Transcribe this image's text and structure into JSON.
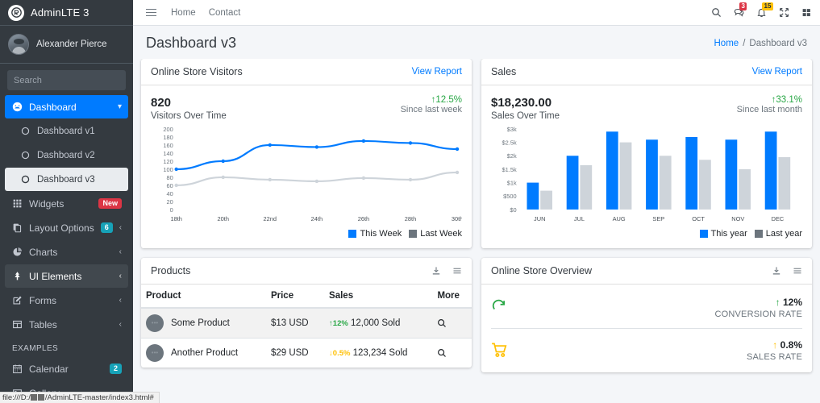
{
  "sidebar": {
    "brand": {
      "title": "AdminLTE 3",
      "logo_icon": "adminlte-logo-icon"
    },
    "user": {
      "name": "Alexander Pierce",
      "avatar_icon": "user-avatar"
    },
    "search": {
      "placeholder": "Search",
      "value": "",
      "button_icon": "search-icon"
    },
    "items": [
      {
        "label": "Dashboard",
        "icon": "tachometer-icon",
        "state": "active",
        "chevron": "⌄",
        "badge": null
      },
      {
        "label": "Dashboard v1",
        "icon": "circle-o-icon",
        "state": "sub",
        "badge": null
      },
      {
        "label": "Dashboard v2",
        "icon": "circle-o-icon",
        "state": "sub",
        "badge": null
      },
      {
        "label": "Dashboard v3",
        "icon": "circle-o-icon",
        "state": "sub-active",
        "badge": null
      },
      {
        "label": "Widgets",
        "icon": "th-icon",
        "state": "normal",
        "badge": {
          "text": "New",
          "color": "red"
        }
      },
      {
        "label": "Layout Options",
        "icon": "copy-icon",
        "state": "normal",
        "badge": {
          "text": "6",
          "color": "teal"
        },
        "chevron": "‹"
      },
      {
        "label": "Charts",
        "icon": "pie-chart-icon",
        "state": "normal",
        "badge": null,
        "chevron": "‹"
      },
      {
        "label": "UI Elements",
        "icon": "tree-icon",
        "state": "active-light",
        "badge": null,
        "chevron": "‹"
      },
      {
        "label": "Forms",
        "icon": "edit-icon",
        "state": "normal",
        "badge": null,
        "chevron": "‹"
      },
      {
        "label": "Tables",
        "icon": "table-icon",
        "state": "normal",
        "badge": null,
        "chevron": "‹"
      }
    ],
    "section_header": "EXAMPLES",
    "examples": [
      {
        "label": "Calendar",
        "icon": "calendar-icon",
        "badge": {
          "text": "2",
          "color": "teal"
        }
      },
      {
        "label": "Gallery",
        "icon": "image-icon",
        "badge": null
      }
    ]
  },
  "navbar": {
    "menu_icon": "hamburger-icon",
    "links": [
      {
        "label": "Home"
      },
      {
        "label": "Contact"
      }
    ],
    "right_icons": [
      {
        "name": "search-icon",
        "badge": null
      },
      {
        "name": "comments-icon",
        "badge": {
          "text": "3",
          "color": "red"
        }
      },
      {
        "name": "bell-icon",
        "badge": {
          "text": "15",
          "color": "yellow"
        }
      },
      {
        "name": "expand-arrows-icon",
        "badge": null
      },
      {
        "name": "th-large-icon",
        "badge": null
      }
    ]
  },
  "content_header": {
    "title": "Dashboard v3",
    "breadcrumb": {
      "home": "Home",
      "separator": "/",
      "current": "Dashboard v3"
    }
  },
  "visitors_card": {
    "title": "Online Store Visitors",
    "view_report": "View Report",
    "value": "820",
    "value_label": "Visitors Over Time",
    "delta": "12.5%",
    "delta_arrow": "↑",
    "delta_sub": "Since last week"
  },
  "sales_card": {
    "title": "Sales",
    "view_report": "View Report",
    "value": "$18,230.00",
    "value_label": "Sales Over Time",
    "delta": "33.1%",
    "delta_arrow": "↑",
    "delta_sub": "Since last month"
  },
  "products_card": {
    "title": "Products",
    "tools": [
      {
        "name": "download-icon"
      },
      {
        "name": "bars-icon"
      }
    ],
    "columns": [
      "Product",
      "Price",
      "Sales",
      "More"
    ],
    "rows": [
      {
        "product": "Some Product",
        "price": "$13 USD",
        "delta": "12%",
        "delta_arrow": "↑",
        "delta_dir": "up",
        "sales": "12,000 Sold",
        "more_icon": "search-icon"
      },
      {
        "product": "Another Product",
        "price": "$29 USD",
        "delta": "0.5%",
        "delta_arrow": "↓",
        "delta_dir": "down",
        "sales": "123,234 Sold",
        "more_icon": "search-icon"
      }
    ]
  },
  "overview_card": {
    "title": "Online Store Overview",
    "tools": [
      {
        "name": "download-icon"
      },
      {
        "name": "bars-icon"
      }
    ],
    "rows": [
      {
        "icon": "refresh-cycle-icon",
        "icon_color": "#28a745",
        "arrow": "↑",
        "arrow_class": "green",
        "value": "12%",
        "caption": "CONVERSION RATE"
      },
      {
        "icon": "shopping-cart-icon",
        "icon_color": "#ffc107",
        "arrow": "↑",
        "arrow_class": "orange",
        "value": "0.8%",
        "caption": "SALES RATE"
      }
    ]
  },
  "statusbar": {
    "text_prefix": "file:///D:/",
    "text_suffix": "/AdminLTE-master/index3.html#"
  },
  "colors": {
    "primary": "#007bff",
    "sidebar_bg": "#343a40",
    "gray_series": "#ced4da",
    "success": "#28a745",
    "warning": "#ffc107",
    "danger": "#dc3545",
    "teal": "#17a2b8"
  },
  "chart_data": [
    {
      "type": "line",
      "title": "Visitors Over Time",
      "xlabel": "",
      "ylabel": "",
      "x": [
        "18th",
        "20th",
        "22nd",
        "24th",
        "26th",
        "28th",
        "30th"
      ],
      "ylim": [
        0,
        200
      ],
      "yticks": [
        0,
        20,
        40,
        60,
        80,
        100,
        120,
        140,
        160,
        180,
        200
      ],
      "grid": false,
      "legend_position": "bottom-right",
      "series": [
        {
          "name": "This Week",
          "color": "#007bff",
          "values": [
            100,
            120,
            160,
            155,
            170,
            165,
            150
          ]
        },
        {
          "name": "Last Week",
          "color": "#ced4da",
          "values": [
            60,
            80,
            74,
            70,
            78,
            74,
            92
          ]
        }
      ]
    },
    {
      "type": "bar",
      "title": "Sales Over Time",
      "xlabel": "",
      "ylabel": "",
      "categories": [
        "JUN",
        "JUL",
        "AUG",
        "SEP",
        "OCT",
        "NOV",
        "DEC"
      ],
      "ylim": [
        0,
        3000
      ],
      "yticks": [
        0,
        500,
        1000,
        1500,
        2000,
        2500,
        3000
      ],
      "ytick_labels": [
        "$0",
        "$500",
        "$1k",
        "$1.5k",
        "$2k",
        "$2.5k",
        "$3k"
      ],
      "grid": false,
      "legend_position": "bottom-right",
      "series": [
        {
          "name": "This year",
          "color": "#007bff",
          "values": [
            1000,
            2000,
            2900,
            2600,
            2700,
            2600,
            2900
          ]
        },
        {
          "name": "Last year",
          "color": "#ced4da",
          "values": [
            700,
            1650,
            2500,
            2000,
            1850,
            1500,
            1950
          ]
        }
      ]
    }
  ]
}
